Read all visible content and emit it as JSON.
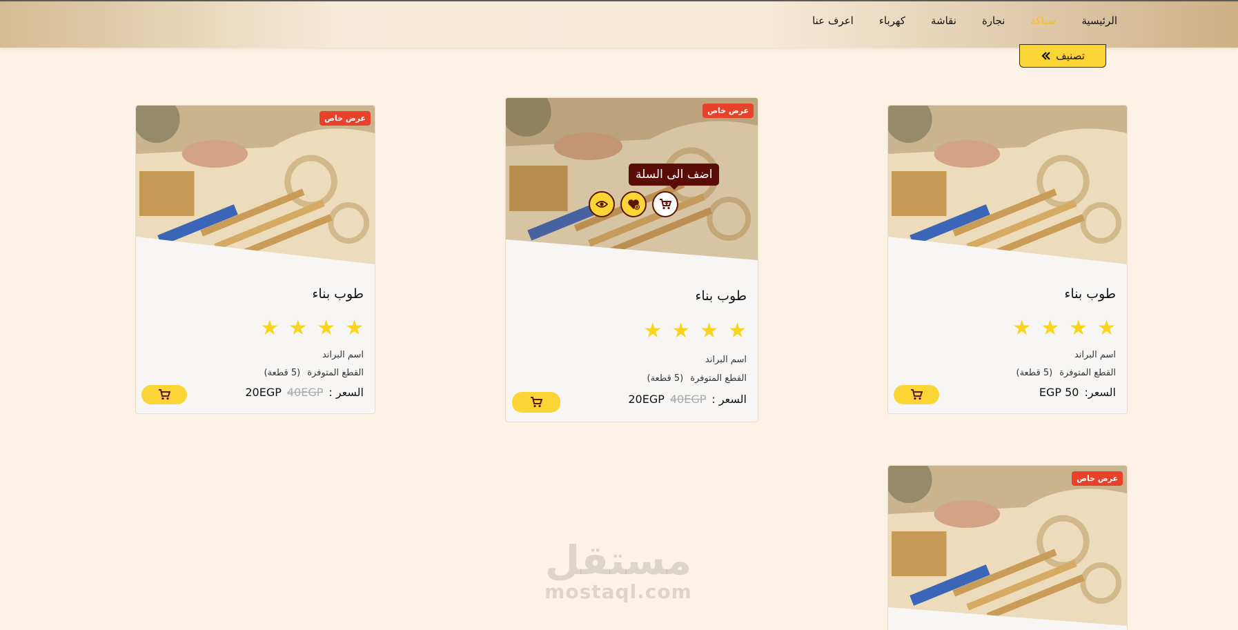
{
  "nav": {
    "items": [
      {
        "label": "الرئيسية",
        "active": false
      },
      {
        "label": "سباكة",
        "active": true
      },
      {
        "label": "نجارة",
        "active": false
      },
      {
        "label": "نقاشة",
        "active": false
      },
      {
        "label": "كهرباء",
        "active": false
      },
      {
        "label": "اعرف عنا",
        "active": false
      }
    ]
  },
  "category_button": {
    "label": "تصنيف",
    "icon": "double-chevron-left-icon"
  },
  "colors": {
    "accent": "#fbd435",
    "badge": "#e8432a",
    "star": "#f8d41c",
    "tooltip": "#5a0d07",
    "active_nav": "#f0c020"
  },
  "products": [
    {
      "badge": "عرض خاص",
      "title": "طوب بناء",
      "rating": 4,
      "brand": "اسم البراند",
      "stock_label": "القطع المتوفرة",
      "stock_value": "(5 قطعة)",
      "price_label": "السعر :",
      "price": "20EGP",
      "old_price": "40EGP"
    },
    {
      "badge": "عرض خاص",
      "title": "طوب بناء",
      "rating": 4,
      "brand": "اسم البراند",
      "stock_label": "القطع المتوفرة",
      "stock_value": "(5 قطعة)",
      "price_label": "السعر :",
      "price": "20EGP",
      "old_price": "40EGP",
      "tooltip": "اضف الى السلة"
    },
    {
      "badge": "",
      "title": "طوب بناء",
      "rating": 4,
      "brand": "اسم البراند",
      "stock_label": "القطع المتوفرة",
      "stock_value": "(5 قطعة)",
      "price_label": "السعر:",
      "price": "50 EGP",
      "old_price": ""
    },
    {
      "badge": "عرض خاص"
    }
  ],
  "watermark": {
    "logo": "مستقل",
    "text": "mostaql.com"
  }
}
